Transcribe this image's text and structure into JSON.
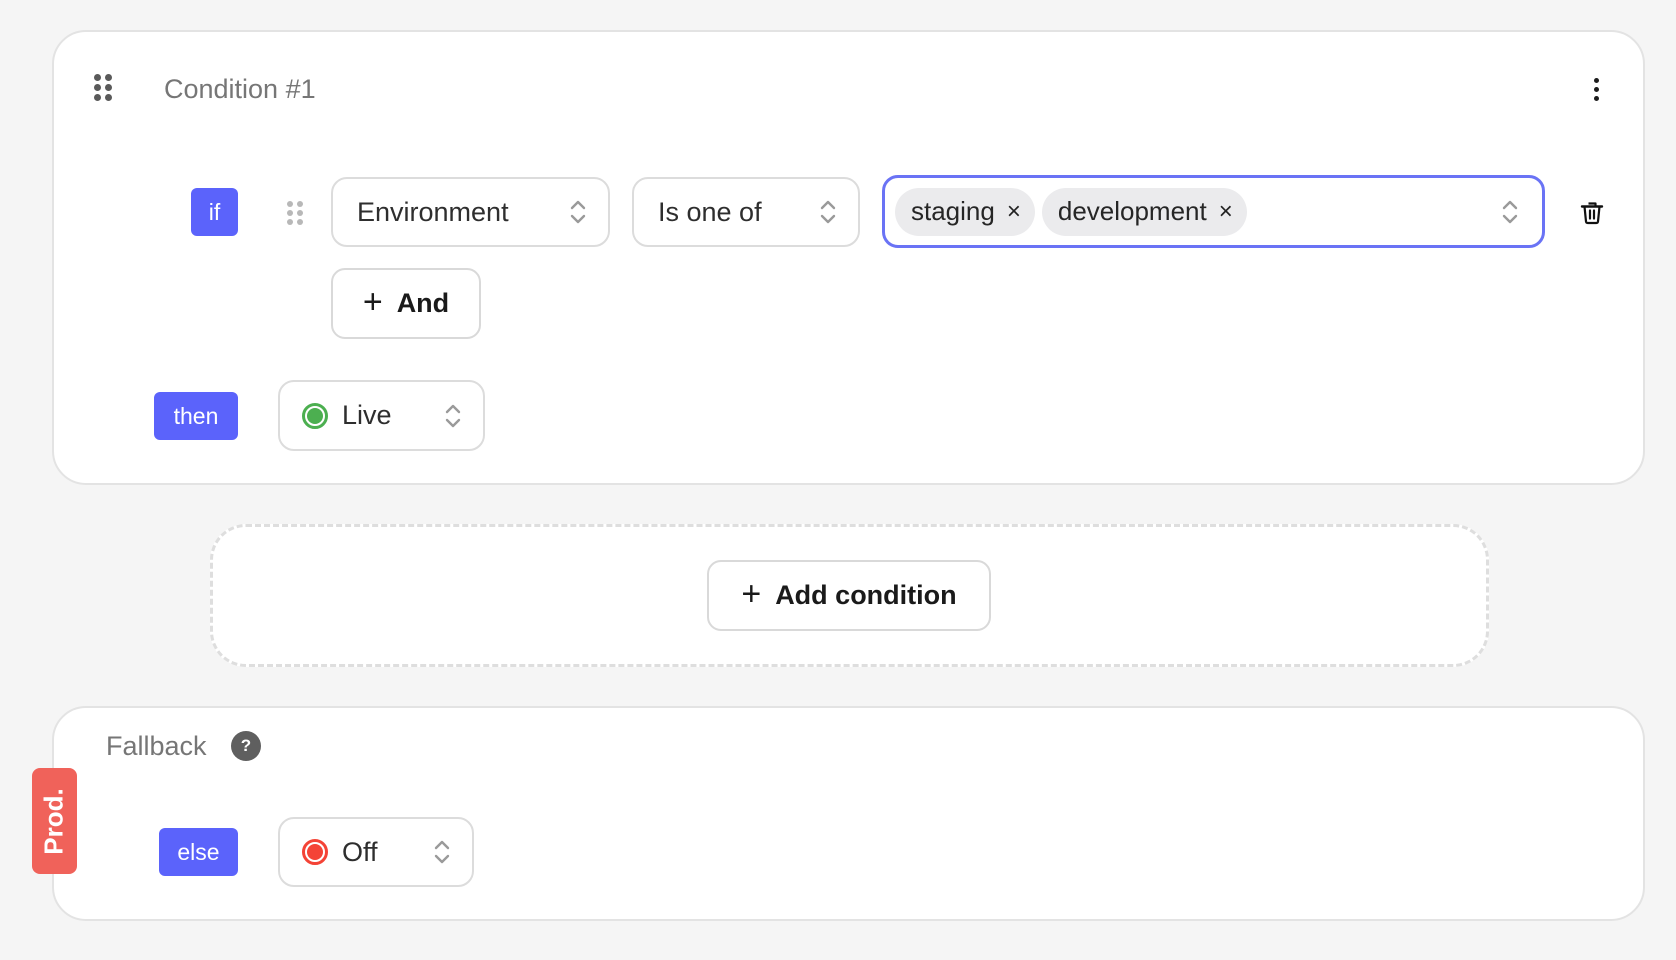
{
  "condition_card": {
    "title": "Condition #1",
    "menu_icon": "kebab-menu-icon",
    "drag_icon": "drag-handle-icon",
    "if_label": "if",
    "rule": {
      "attribute": "Environment",
      "operator": "Is one of",
      "values": [
        {
          "label": "staging",
          "remove_glyph": "×"
        },
        {
          "label": "development",
          "remove_glyph": "×"
        }
      ],
      "delete_icon": "trash-icon"
    },
    "and_button": {
      "plus": "+",
      "label": "And"
    },
    "then_label": "then",
    "then_value": {
      "label": "Live",
      "color": "#4caf50"
    }
  },
  "add_condition_button": {
    "plus": "+",
    "label": "Add condition"
  },
  "fallback_card": {
    "title": "Fallback",
    "help_glyph": "?",
    "environment_tag": "Prod.",
    "environment_tag_color": "#f0625a",
    "else_label": "else",
    "else_value": {
      "label": "Off",
      "color": "#f44336"
    }
  },
  "accent_color": "#5b63fb",
  "focus_color": "#6a73f5"
}
